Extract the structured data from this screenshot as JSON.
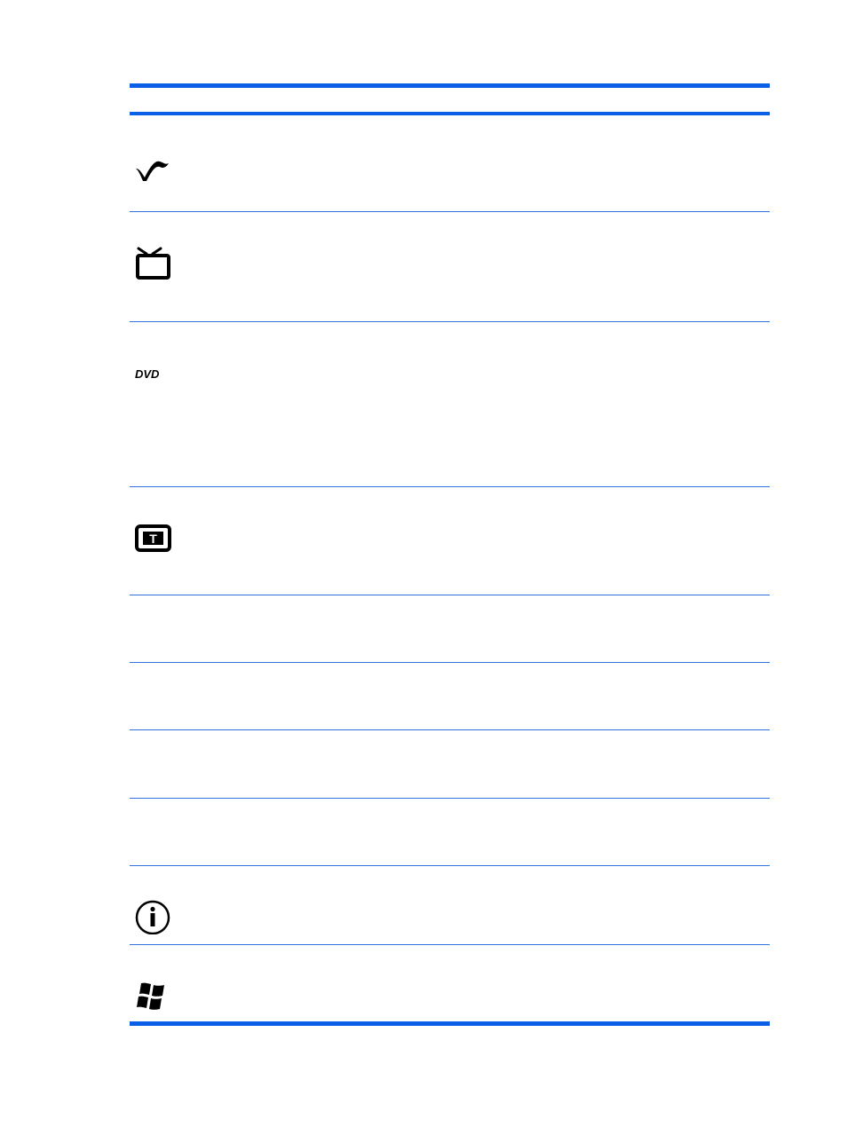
{
  "table": {
    "rows": [
      {
        "icon": "green-button-icon"
      },
      {
        "icon": "live-tv-icon"
      },
      {
        "icon": "dvd-menu-icon"
      },
      {
        "icon": "teletext-icon"
      },
      {
        "icon": ""
      },
      {
        "icon": ""
      },
      {
        "icon": ""
      },
      {
        "icon": ""
      },
      {
        "icon": "info-icon"
      },
      {
        "icon": "windows-logo-icon"
      }
    ]
  },
  "dvd_icon": {
    "label": "DVD"
  },
  "teletext_icon": {
    "label": "T"
  },
  "colors": {
    "rule": "#0a5fe6",
    "icon": "#000000",
    "background": "#ffffff"
  }
}
